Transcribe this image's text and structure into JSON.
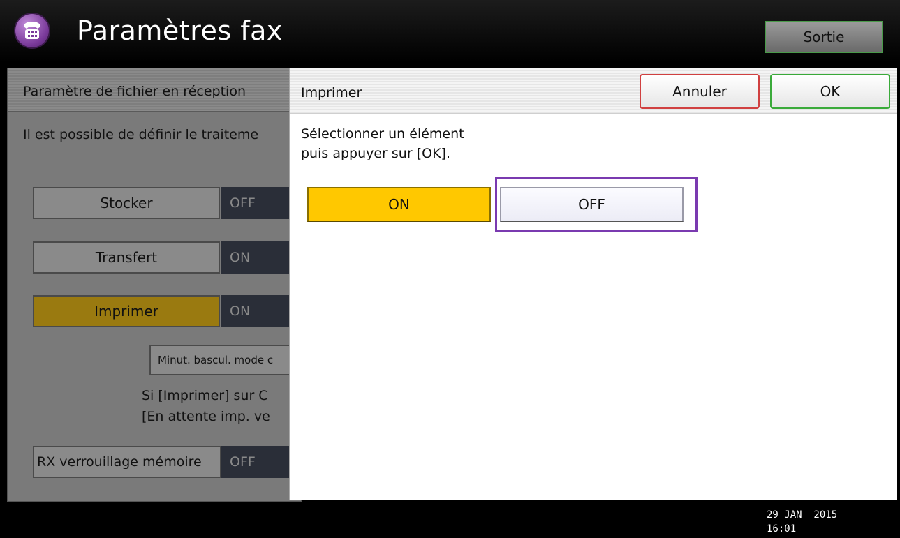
{
  "header": {
    "app_icon": "fax-icon",
    "title": "Paramètres fax",
    "exit_label": "Sortie"
  },
  "background_panel": {
    "title": "Paramètre de fichier en réception",
    "description": "Il est possible de définir le traiteme",
    "rows": [
      {
        "label": "Stocker",
        "value": "OFF"
      },
      {
        "label": "Transfert",
        "value": "ON"
      },
      {
        "label": "Imprimer",
        "value": "ON"
      }
    ],
    "timer_button_label": "Minut. bascul. mode c",
    "note_line1": "Si [Imprimer] sur C",
    "note_line2": "[En attente imp. ve",
    "memory_lock": {
      "label": "RX verrouillage mémoire",
      "value": "OFF"
    }
  },
  "dialog": {
    "title": "Imprimer",
    "cancel_label": "Annuler",
    "ok_label": "OK",
    "message_line1": "Sélectionner un élément",
    "message_line2": "puis appuyer sur [OK].",
    "option_on": "ON",
    "option_off": "OFF",
    "selected_option": "ON"
  },
  "status_bar": {
    "date": "29 JAN  2015",
    "time": "16:01"
  },
  "colors": {
    "selected_option": "#ffc800",
    "highlight_frame": "#7a3ab0",
    "ok_border": "#3aaa3a",
    "cancel_border": "#d04040"
  }
}
